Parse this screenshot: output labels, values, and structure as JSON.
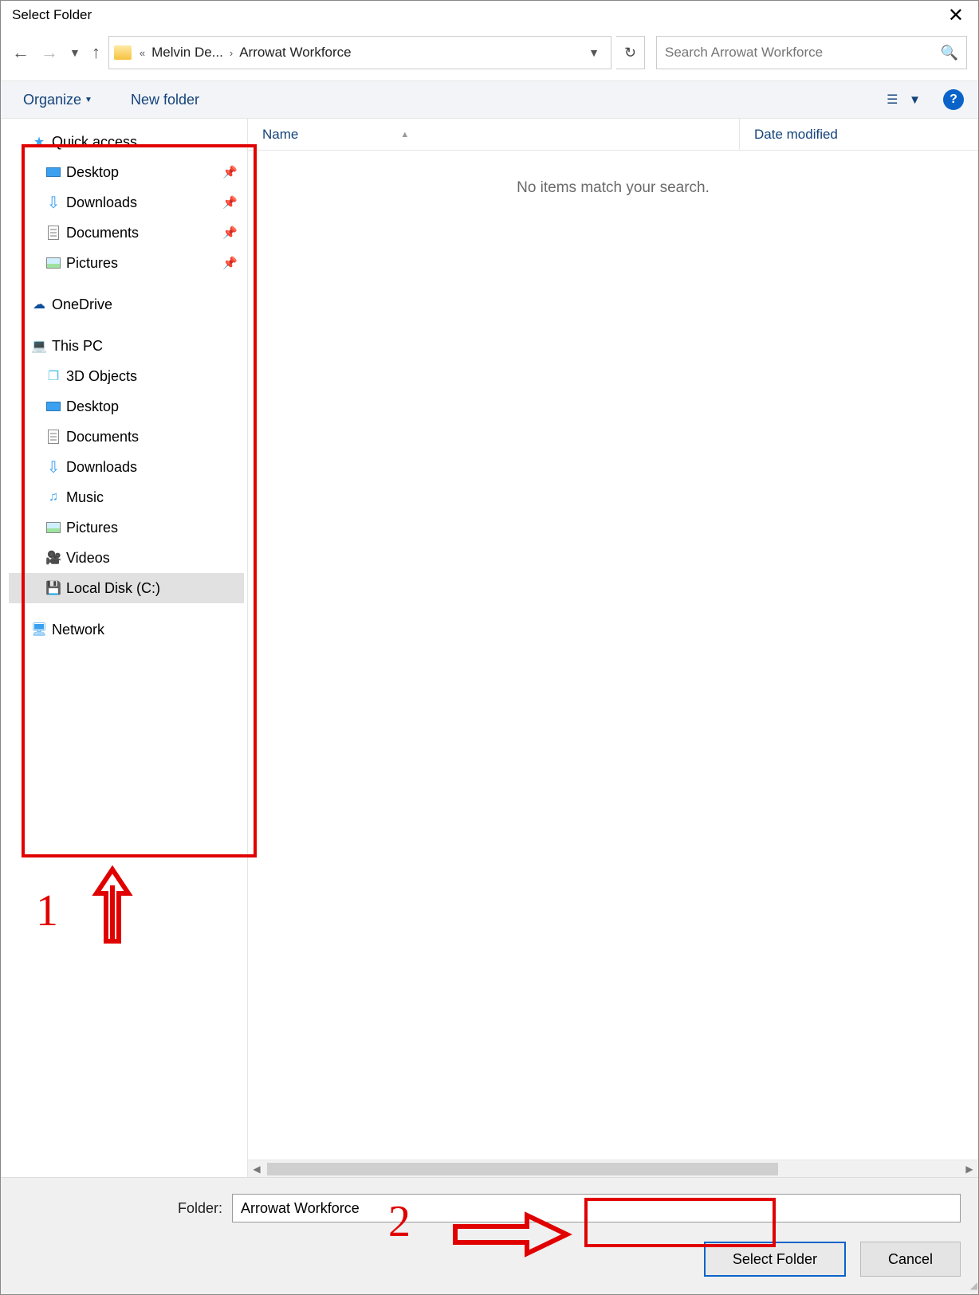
{
  "title": "Select Folder",
  "breadcrumb": {
    "seg1": "Melvin De...",
    "seg2": "Arrowat Workforce"
  },
  "search": {
    "placeholder": "Search Arrowat Workforce"
  },
  "commands": {
    "organize": "Organize",
    "newfolder": "New folder"
  },
  "help_label": "?",
  "columns": {
    "name": "Name",
    "date": "Date modified"
  },
  "empty": "No items match your search.",
  "tree": {
    "quick": "Quick access",
    "quick_children": [
      {
        "label": "Desktop",
        "pinned": true
      },
      {
        "label": "Downloads",
        "pinned": true
      },
      {
        "label": "Documents",
        "pinned": true
      },
      {
        "label": "Pictures",
        "pinned": true
      }
    ],
    "onedrive": "OneDrive",
    "thispc": "This PC",
    "thispc_children": [
      {
        "label": "3D Objects"
      },
      {
        "label": "Desktop"
      },
      {
        "label": "Documents"
      },
      {
        "label": "Downloads"
      },
      {
        "label": "Music"
      },
      {
        "label": "Pictures"
      },
      {
        "label": "Videos"
      },
      {
        "label": "Local Disk (C:)",
        "selected": true
      }
    ],
    "network": "Network"
  },
  "footer": {
    "label": "Folder:",
    "value": "Arrowat Workforce",
    "select": "Select Folder",
    "cancel": "Cancel"
  },
  "annotations": {
    "num1": "1",
    "num2": "2"
  }
}
